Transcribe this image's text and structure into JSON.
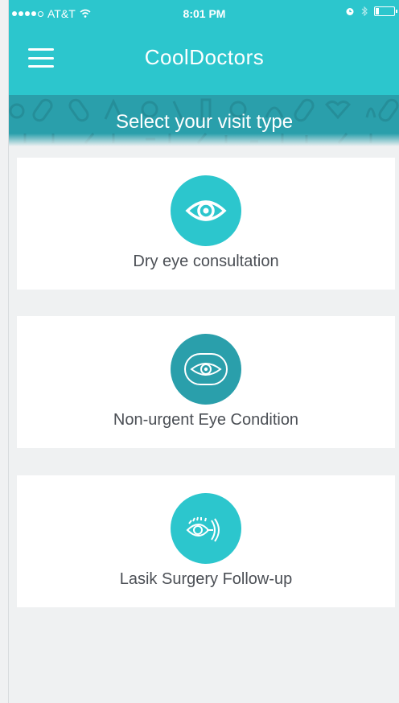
{
  "status": {
    "carrier": "AT&T",
    "time": "8:01 PM"
  },
  "header": {
    "title": "CoolDoctors"
  },
  "banner": {
    "title": "Select your visit type"
  },
  "visit_types": [
    {
      "label": "Dry eye consultation",
      "icon": "eye-icon",
      "color": "#2cc6cd"
    },
    {
      "label": "Non-urgent Eye Condition",
      "icon": "eye-icon",
      "color": "#2a9fab"
    },
    {
      "label": "Lasik Surgery Follow-up",
      "icon": "eye-lens-icon",
      "color": "#2cc6cd"
    }
  ],
  "colors": {
    "primary": "#2cc6cd",
    "banner": "#2a9fab",
    "background": "#eff1f2",
    "text": "#4b4f55"
  }
}
